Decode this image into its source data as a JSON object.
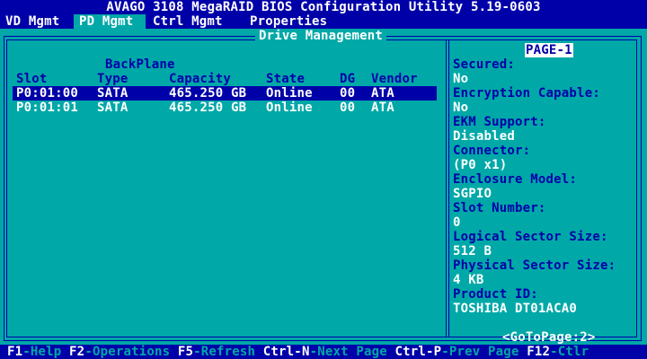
{
  "title": "AVAGO 3108 MegaRAID BIOS Configuration Utility 5.19-0603",
  "menu": [
    {
      "label": "VD Mgmt",
      "active": false
    },
    {
      "label": "PD Mgmt",
      "active": true
    },
    {
      "label": "Ctrl Mgmt",
      "active": false
    },
    {
      "label": "Properties",
      "active": false
    }
  ],
  "panel": {
    "title": "Drive Management",
    "backplane_label": "BackPlane",
    "columns": {
      "slot": "Slot",
      "type": "Type",
      "capacity": "Capacity",
      "state": "State",
      "dg": "DG",
      "vendor": "Vendor"
    },
    "drives": [
      {
        "slot": "P0:01:00",
        "type": "SATA",
        "capacity": "465.250 GB",
        "state": "Online",
        "dg": "00",
        "vendor": "ATA",
        "selected": true
      },
      {
        "slot": "P0:01:01",
        "type": "SATA",
        "capacity": "465.250 GB",
        "state": "Online",
        "dg": "00",
        "vendor": "ATA",
        "selected": false
      }
    ]
  },
  "properties": {
    "page_label": "PAGE-1",
    "items": [
      {
        "label": "Secured:",
        "value": "No"
      },
      {
        "label": "Encryption Capable:",
        "value": "No"
      },
      {
        "label": "EKM Support:",
        "value": "Disabled"
      },
      {
        "label": "Connector:",
        "value": "(P0 x1)"
      },
      {
        "label": "Enclosure Model:",
        "value": "SGPIO"
      },
      {
        "label": "Slot Number:",
        "value": "0"
      },
      {
        "label": "Logical Sector Size:",
        "value": "512 B"
      },
      {
        "label": "Physical Sector Size:",
        "value": "4 KB"
      },
      {
        "label": "Product ID:",
        "value": "TOSHIBA DT01ACA0"
      }
    ],
    "goto_label": "<GoToPage:2>"
  },
  "status": [
    {
      "key": "F1",
      "desc": "-Help "
    },
    {
      "key": "F2",
      "desc": "-Operations "
    },
    {
      "key": "F5",
      "desc": "-Refresh "
    },
    {
      "key": "Ctrl-N",
      "desc": "-Next Page "
    },
    {
      "key": "Ctrl-P",
      "desc": "-Prev Page "
    },
    {
      "key": "F12",
      "desc": "-Ctlr"
    }
  ],
  "colors": {
    "background": "#00a8a8",
    "bar": "#0000a8",
    "text": "#ffffff"
  }
}
